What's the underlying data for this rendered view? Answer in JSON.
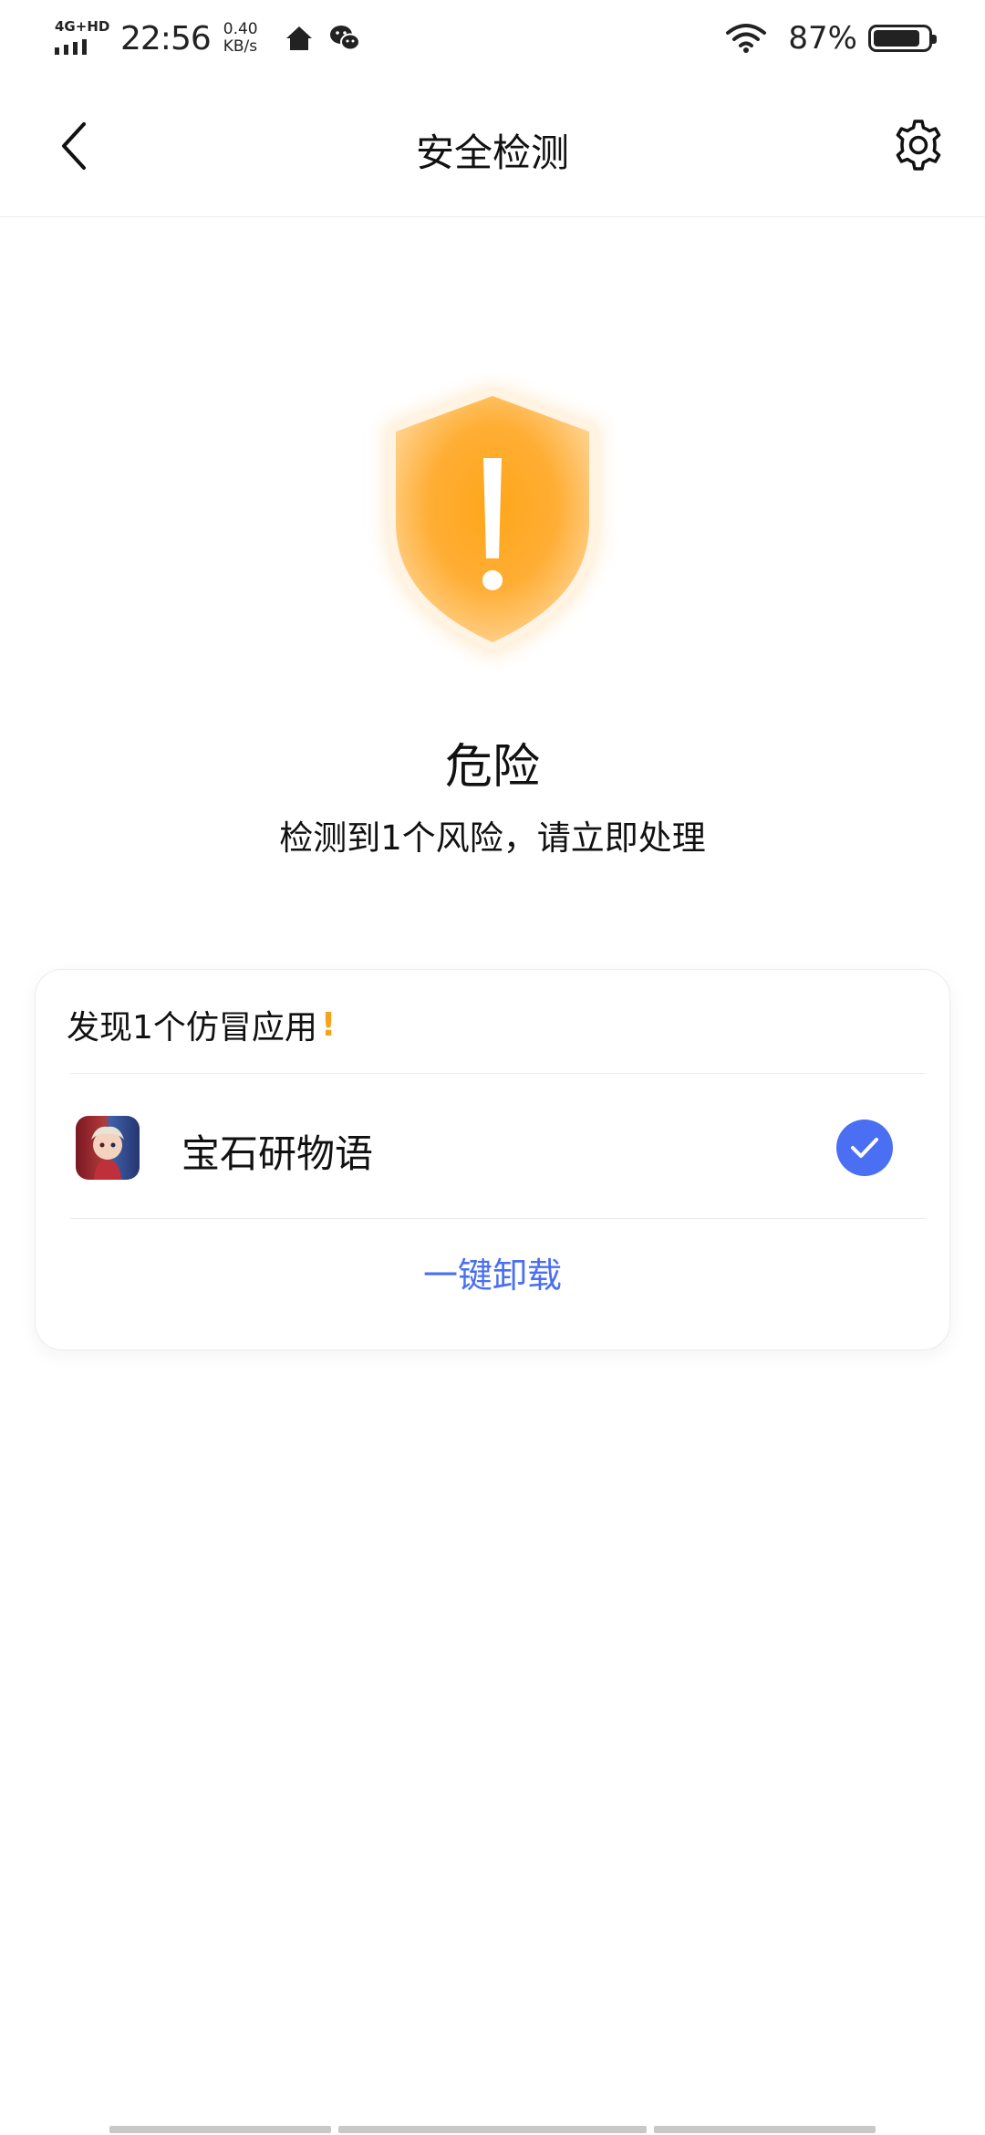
{
  "status_bar": {
    "network": "4G+HD",
    "time": "22:56",
    "speed_value": "0.40",
    "speed_unit": "KB/s",
    "battery_text": "87%",
    "battery_level": 0.87,
    "icons": [
      "home-icon",
      "wechat-icon",
      "wifi-icon",
      "battery-icon"
    ]
  },
  "nav": {
    "title": "安全检测",
    "back_icon": "chevron-left-icon",
    "settings_icon": "gear-icon"
  },
  "result": {
    "shield_icon": "warning-shield-icon",
    "shield_color": "#ffa21f",
    "status_title": "危险",
    "status_subtitle": "检测到1个风险，请立即处理"
  },
  "card": {
    "header_text": "发现1个仿冒应用",
    "header_mark": "!",
    "app": {
      "name": "宝石研物语",
      "selected": true
    },
    "action_label": "一键卸载",
    "accent_color": "#4a6ff2"
  }
}
